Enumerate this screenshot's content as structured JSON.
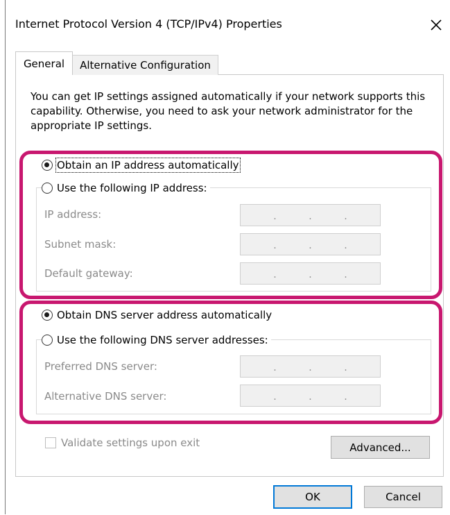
{
  "window": {
    "title": "Internet Protocol Version 4 (TCP/IPv4) Properties",
    "close_icon": "close-icon"
  },
  "tabs": [
    {
      "label": "General",
      "selected": true
    },
    {
      "label": "Alternative Configuration",
      "selected": false
    }
  ],
  "intro_text": "You can get IP settings assigned automatically if your network supports this capability. Otherwise, you need to ask your network administrator for the appropriate IP settings.",
  "ip_section": {
    "auto_option": {
      "label": "Obtain an IP address automatically",
      "checked": true
    },
    "manual_option": {
      "label": "Use the following IP address:",
      "checked": false
    },
    "fields": [
      {
        "label": "IP address:",
        "value": ". . ."
      },
      {
        "label": "Subnet mask:",
        "value": ". . ."
      },
      {
        "label": "Default gateway:",
        "value": ". . ."
      }
    ]
  },
  "dns_section": {
    "auto_option": {
      "label": "Obtain DNS server address automatically",
      "checked": true
    },
    "manual_option": {
      "label": "Use the following DNS server addresses:",
      "checked": false
    },
    "fields": [
      {
        "label": "Preferred DNS server:",
        "value": ". . ."
      },
      {
        "label": "Alternative DNS server:",
        "value": ". . ."
      }
    ]
  },
  "validate_checkbox": {
    "label": "Validate settings upon exit",
    "checked": false
  },
  "buttons": {
    "advanced": "Advanced...",
    "ok": "OK",
    "cancel": "Cancel"
  },
  "colors": {
    "highlight": "#c8176f",
    "ok_border": "#0078d7"
  }
}
